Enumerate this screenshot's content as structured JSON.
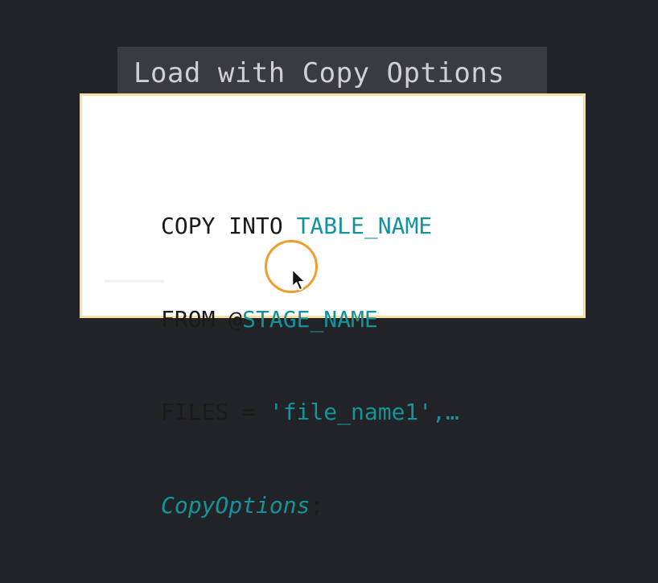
{
  "slide": {
    "title": "Load with Copy Options"
  },
  "code": {
    "line1": {
      "keyword": "COPY INTO ",
      "identifier": "TABLE_NAME"
    },
    "line2": {
      "keyword": "FROM @",
      "identifier": "STAGE_NAME"
    },
    "line3": {
      "keyword": "FILES = ",
      "string": "'file_name1',…"
    },
    "line4": {
      "option": "CopyOptions",
      "terminator": ";"
    }
  },
  "colors": {
    "background": "#222326",
    "title_bar": "#3a3b40",
    "accent": "#14939b",
    "card_border": "#f6dfa0",
    "click_ring": "#ef9d2e"
  },
  "icons": [
    "mouse-pointer-icon",
    "click-highlight-ring"
  ]
}
